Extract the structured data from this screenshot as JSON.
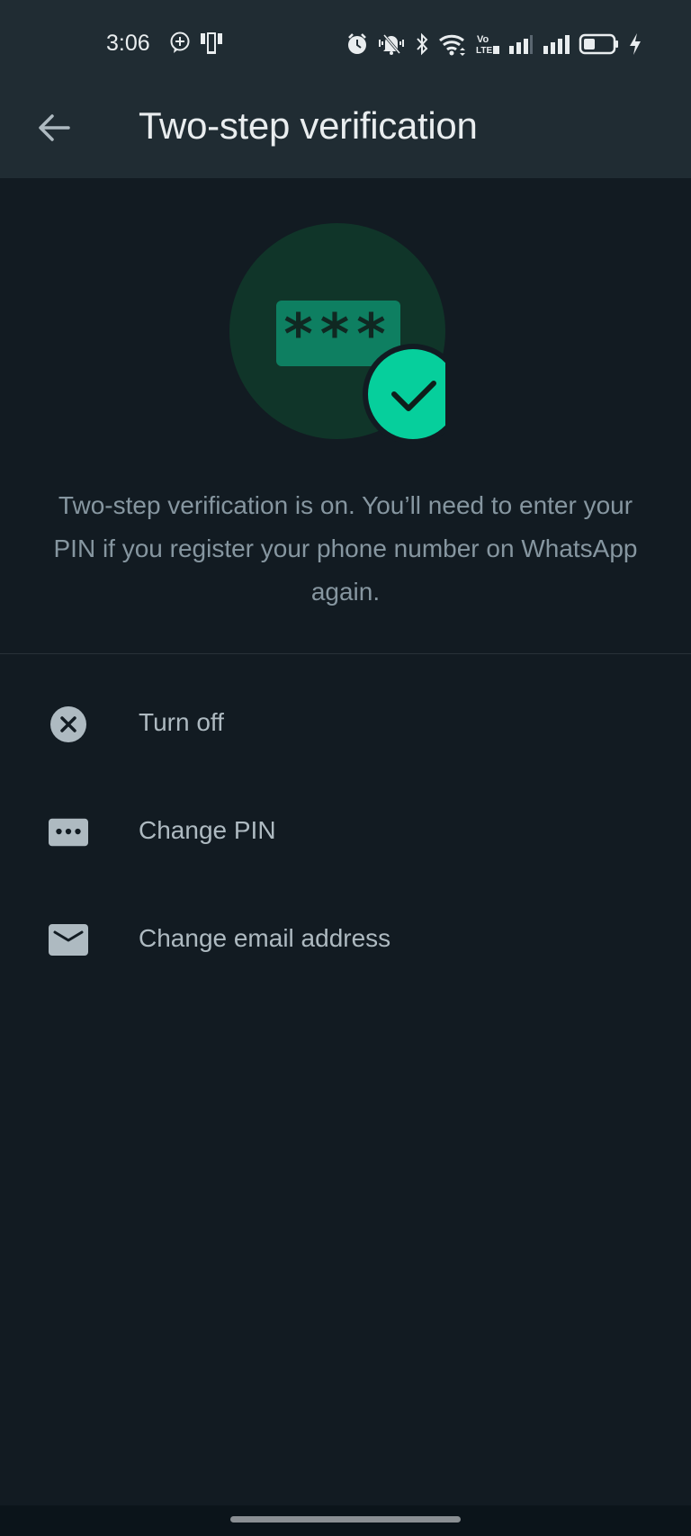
{
  "status_bar": {
    "time": "3:06",
    "left_icons": [
      "whatsapp-bubble-icon",
      "screen-cast-icon"
    ],
    "right_icons": [
      "alarm-icon",
      "vibrate-mute-icon",
      "bluetooth-icon",
      "wifi-icon",
      "volte2-icon",
      "signal-sim1-icon",
      "signal-sim2-icon",
      "battery-icon",
      "charging-bolt-icon"
    ],
    "volte_label": "Vo LTE2"
  },
  "app_bar": {
    "back_icon": "arrow-back-icon",
    "title": "Two-step verification"
  },
  "hero": {
    "pin_mask": "***",
    "colors": {
      "circle": "#103529",
      "pin_box": "#0E7F61",
      "check_badge": "#06CF9C"
    }
  },
  "description": "Two-step verification is on. You’ll need to enter your PIN if you register your phone number on WhatsApp again.",
  "menu": {
    "items": [
      {
        "label": "Turn off",
        "icon": "cancel-circle-icon"
      },
      {
        "label": "Change PIN",
        "icon": "pin-dots-icon"
      },
      {
        "label": "Change email address",
        "icon": "email-icon"
      }
    ]
  },
  "colors": {
    "background": "#121B22",
    "header": "#202C33",
    "accent": "#06CF9C",
    "text_primary": "#E9EDEF",
    "text_secondary": "#8696A0"
  }
}
